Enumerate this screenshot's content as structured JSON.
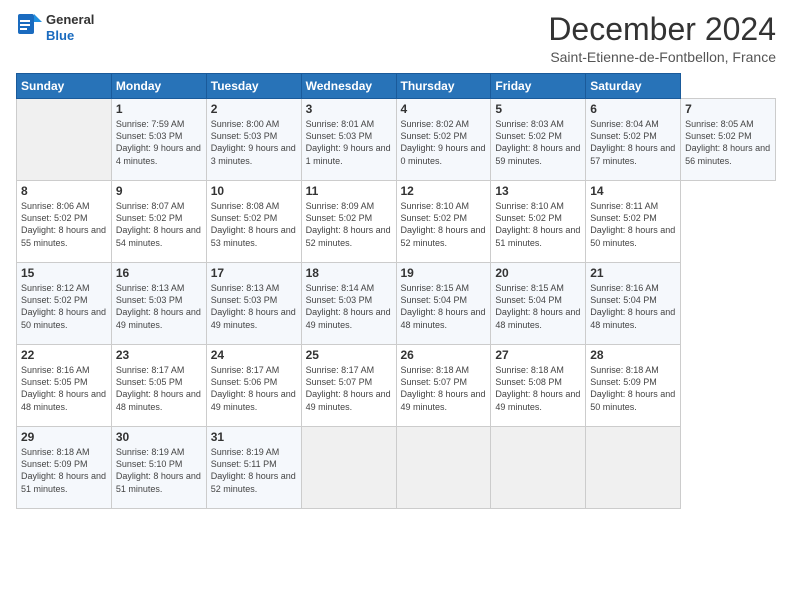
{
  "header": {
    "logo": {
      "line1": "General",
      "line2": "Blue"
    },
    "title": "December 2024",
    "subtitle": "Saint-Etienne-de-Fontbellon, France"
  },
  "calendar": {
    "weekdays": [
      "Sunday",
      "Monday",
      "Tuesday",
      "Wednesday",
      "Thursday",
      "Friday",
      "Saturday"
    ],
    "weeks": [
      [
        null,
        {
          "day": 1,
          "sunrise": "Sunrise: 7:59 AM",
          "sunset": "Sunset: 5:03 PM",
          "daylight": "Daylight: 9 hours and 4 minutes."
        },
        {
          "day": 2,
          "sunrise": "Sunrise: 8:00 AM",
          "sunset": "Sunset: 5:03 PM",
          "daylight": "Daylight: 9 hours and 3 minutes."
        },
        {
          "day": 3,
          "sunrise": "Sunrise: 8:01 AM",
          "sunset": "Sunset: 5:03 PM",
          "daylight": "Daylight: 9 hours and 1 minute."
        },
        {
          "day": 4,
          "sunrise": "Sunrise: 8:02 AM",
          "sunset": "Sunset: 5:02 PM",
          "daylight": "Daylight: 9 hours and 0 minutes."
        },
        {
          "day": 5,
          "sunrise": "Sunrise: 8:03 AM",
          "sunset": "Sunset: 5:02 PM",
          "daylight": "Daylight: 8 hours and 59 minutes."
        },
        {
          "day": 6,
          "sunrise": "Sunrise: 8:04 AM",
          "sunset": "Sunset: 5:02 PM",
          "daylight": "Daylight: 8 hours and 57 minutes."
        },
        {
          "day": 7,
          "sunrise": "Sunrise: 8:05 AM",
          "sunset": "Sunset: 5:02 PM",
          "daylight": "Daylight: 8 hours and 56 minutes."
        }
      ],
      [
        {
          "day": 8,
          "sunrise": "Sunrise: 8:06 AM",
          "sunset": "Sunset: 5:02 PM",
          "daylight": "Daylight: 8 hours and 55 minutes."
        },
        {
          "day": 9,
          "sunrise": "Sunrise: 8:07 AM",
          "sunset": "Sunset: 5:02 PM",
          "daylight": "Daylight: 8 hours and 54 minutes."
        },
        {
          "day": 10,
          "sunrise": "Sunrise: 8:08 AM",
          "sunset": "Sunset: 5:02 PM",
          "daylight": "Daylight: 8 hours and 53 minutes."
        },
        {
          "day": 11,
          "sunrise": "Sunrise: 8:09 AM",
          "sunset": "Sunset: 5:02 PM",
          "daylight": "Daylight: 8 hours and 52 minutes."
        },
        {
          "day": 12,
          "sunrise": "Sunrise: 8:10 AM",
          "sunset": "Sunset: 5:02 PM",
          "daylight": "Daylight: 8 hours and 52 minutes."
        },
        {
          "day": 13,
          "sunrise": "Sunrise: 8:10 AM",
          "sunset": "Sunset: 5:02 PM",
          "daylight": "Daylight: 8 hours and 51 minutes."
        },
        {
          "day": 14,
          "sunrise": "Sunrise: 8:11 AM",
          "sunset": "Sunset: 5:02 PM",
          "daylight": "Daylight: 8 hours and 50 minutes."
        }
      ],
      [
        {
          "day": 15,
          "sunrise": "Sunrise: 8:12 AM",
          "sunset": "Sunset: 5:02 PM",
          "daylight": "Daylight: 8 hours and 50 minutes."
        },
        {
          "day": 16,
          "sunrise": "Sunrise: 8:13 AM",
          "sunset": "Sunset: 5:03 PM",
          "daylight": "Daylight: 8 hours and 49 minutes."
        },
        {
          "day": 17,
          "sunrise": "Sunrise: 8:13 AM",
          "sunset": "Sunset: 5:03 PM",
          "daylight": "Daylight: 8 hours and 49 minutes."
        },
        {
          "day": 18,
          "sunrise": "Sunrise: 8:14 AM",
          "sunset": "Sunset: 5:03 PM",
          "daylight": "Daylight: 8 hours and 49 minutes."
        },
        {
          "day": 19,
          "sunrise": "Sunrise: 8:15 AM",
          "sunset": "Sunset: 5:04 PM",
          "daylight": "Daylight: 8 hours and 48 minutes."
        },
        {
          "day": 20,
          "sunrise": "Sunrise: 8:15 AM",
          "sunset": "Sunset: 5:04 PM",
          "daylight": "Daylight: 8 hours and 48 minutes."
        },
        {
          "day": 21,
          "sunrise": "Sunrise: 8:16 AM",
          "sunset": "Sunset: 5:04 PM",
          "daylight": "Daylight: 8 hours and 48 minutes."
        }
      ],
      [
        {
          "day": 22,
          "sunrise": "Sunrise: 8:16 AM",
          "sunset": "Sunset: 5:05 PM",
          "daylight": "Daylight: 8 hours and 48 minutes."
        },
        {
          "day": 23,
          "sunrise": "Sunrise: 8:17 AM",
          "sunset": "Sunset: 5:05 PM",
          "daylight": "Daylight: 8 hours and 48 minutes."
        },
        {
          "day": 24,
          "sunrise": "Sunrise: 8:17 AM",
          "sunset": "Sunset: 5:06 PM",
          "daylight": "Daylight: 8 hours and 49 minutes."
        },
        {
          "day": 25,
          "sunrise": "Sunrise: 8:17 AM",
          "sunset": "Sunset: 5:07 PM",
          "daylight": "Daylight: 8 hours and 49 minutes."
        },
        {
          "day": 26,
          "sunrise": "Sunrise: 8:18 AM",
          "sunset": "Sunset: 5:07 PM",
          "daylight": "Daylight: 8 hours and 49 minutes."
        },
        {
          "day": 27,
          "sunrise": "Sunrise: 8:18 AM",
          "sunset": "Sunset: 5:08 PM",
          "daylight": "Daylight: 8 hours and 49 minutes."
        },
        {
          "day": 28,
          "sunrise": "Sunrise: 8:18 AM",
          "sunset": "Sunset: 5:09 PM",
          "daylight": "Daylight: 8 hours and 50 minutes."
        }
      ],
      [
        {
          "day": 29,
          "sunrise": "Sunrise: 8:18 AM",
          "sunset": "Sunset: 5:09 PM",
          "daylight": "Daylight: 8 hours and 51 minutes."
        },
        {
          "day": 30,
          "sunrise": "Sunrise: 8:19 AM",
          "sunset": "Sunset: 5:10 PM",
          "daylight": "Daylight: 8 hours and 51 minutes."
        },
        {
          "day": 31,
          "sunrise": "Sunrise: 8:19 AM",
          "sunset": "Sunset: 5:11 PM",
          "daylight": "Daylight: 8 hours and 52 minutes."
        },
        null,
        null,
        null,
        null
      ]
    ]
  }
}
